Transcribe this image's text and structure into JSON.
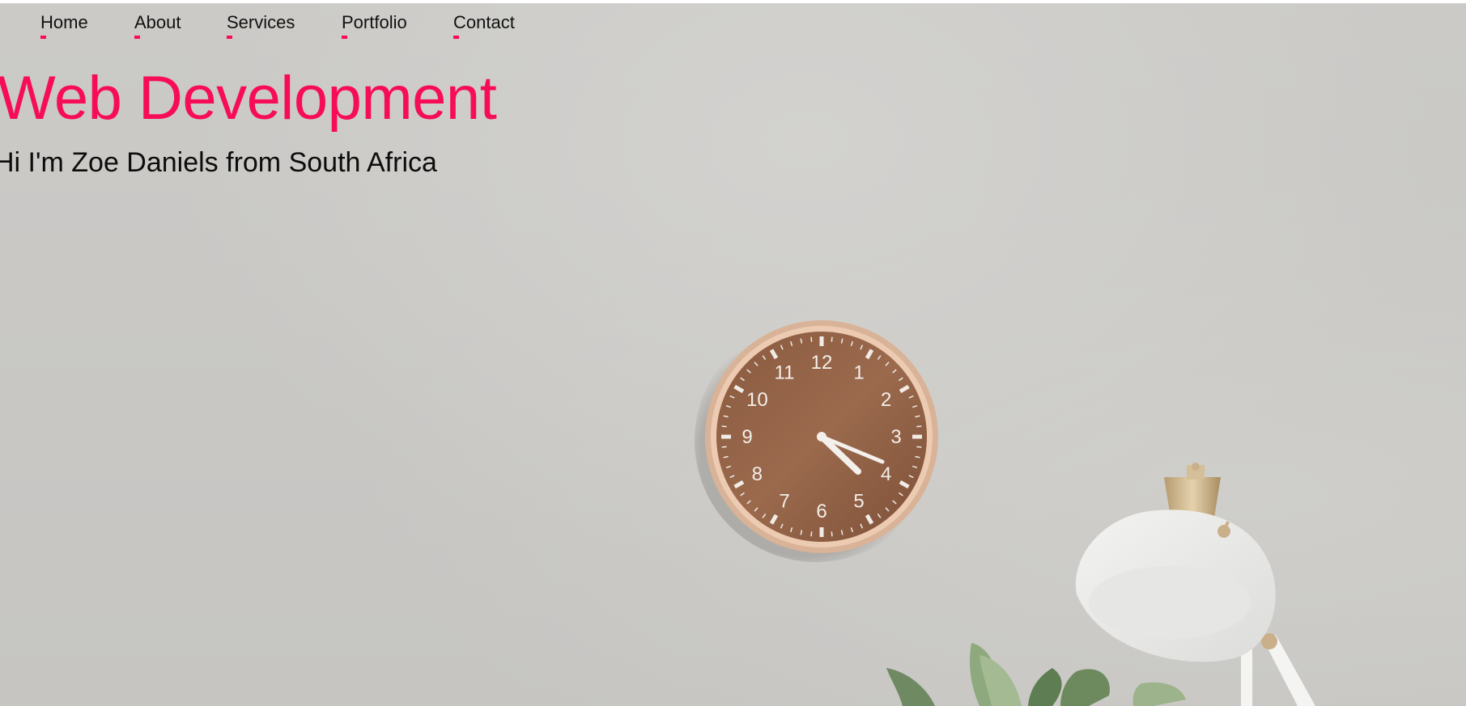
{
  "nav": {
    "items": [
      {
        "label": "Home"
      },
      {
        "label": "About"
      },
      {
        "label": "Services"
      },
      {
        "label": "Portfolio"
      },
      {
        "label": "Contact"
      }
    ]
  },
  "hero": {
    "title": "Web Development",
    "subtitle": "Hi I'm Zoe Daniels from South Africa"
  },
  "background": {
    "clock_numbers": [
      "12",
      "1",
      "2",
      "3",
      "4",
      "5",
      "6",
      "7",
      "8",
      "9",
      "10",
      "11"
    ]
  },
  "colors": {
    "accent": "#f70d57",
    "wall": "#c9c8c5",
    "text": "#111111"
  }
}
